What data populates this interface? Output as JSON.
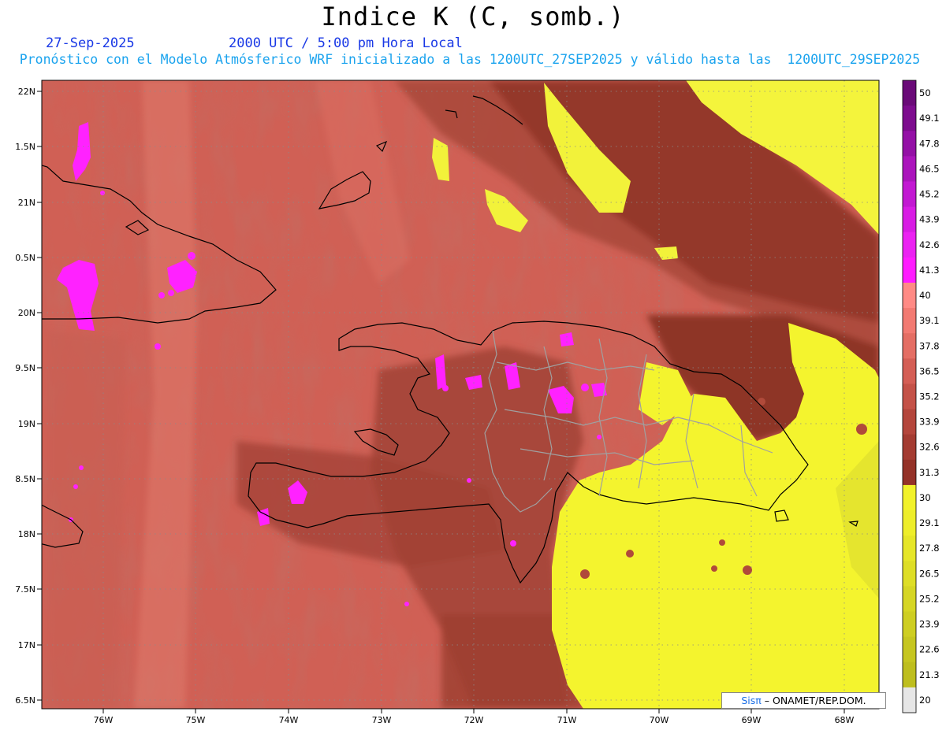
{
  "title": "Indice K (C, somb.)",
  "date": "27-Sep-2025",
  "time": "2000 UTC / 5:00 pm Hora Local",
  "subtitle": "Pronóstico con el Modelo Atmósferico WRF inicializado a las 1200UTC_27SEP2025 y válido hasta las  1200UTC_29SEP2025",
  "map": {
    "lon_labels": [
      "76W",
      "75W",
      "74W",
      "73W",
      "72W",
      "71W",
      "70W",
      "69W",
      "68W"
    ],
    "lat_labels": [
      "22N",
      "1.5N",
      "21N",
      "0.5N",
      "20N",
      "9.5N",
      "19N",
      "8.5N",
      "18N",
      "7.5N",
      "17N",
      "6.5N"
    ],
    "grid": true
  },
  "colorbar": {
    "labels": [
      "50",
      "49.1",
      "47.8",
      "46.5",
      "45.2",
      "43.9",
      "42.6",
      "41.3",
      "40",
      "39.1",
      "37.8",
      "36.5",
      "35.2",
      "33.9",
      "32.6",
      "31.3",
      "30",
      "29.1",
      "27.8",
      "26.5",
      "25.2",
      "23.9",
      "22.6",
      "21.3",
      "20"
    ],
    "colors": [
      "#6a0a78",
      "#7d0c8e",
      "#9410a6",
      "#ab14bc",
      "#c218d2",
      "#d81ce4",
      "#eb22f2",
      "#ff1cff",
      "#ff8a85",
      "#f27a72",
      "#e46e64",
      "#d45e55",
      "#c45248",
      "#b4463c",
      "#a43c32",
      "#943228",
      "#f2f22a",
      "#eeee2a",
      "#e6e628",
      "#dede26",
      "#d6d624",
      "#cece22",
      "#c6c620",
      "#bebe1e",
      "#e6e6e6"
    ]
  },
  "credit": {
    "sis": "Sisπ",
    "rest": " – ONAMET/REP.DOM."
  }
}
